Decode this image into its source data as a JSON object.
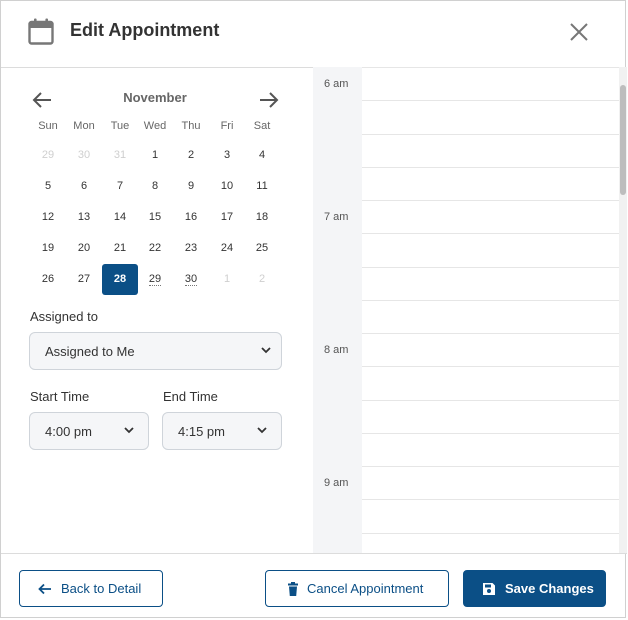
{
  "header": {
    "title": "Edit Appointment",
    "icon": "calendar-icon",
    "close_icon": "close-icon"
  },
  "calendar": {
    "month": "November",
    "weekdays": [
      "Sun",
      "Mon",
      "Tue",
      "Wed",
      "Thu",
      "Fri",
      "Sat"
    ],
    "weeks": [
      [
        {
          "d": "29",
          "m": true
        },
        {
          "d": "30",
          "m": true
        },
        {
          "d": "31",
          "m": true
        },
        {
          "d": "1"
        },
        {
          "d": "2"
        },
        {
          "d": "3"
        },
        {
          "d": "4"
        }
      ],
      [
        {
          "d": "5"
        },
        {
          "d": "6"
        },
        {
          "d": "7"
        },
        {
          "d": "8"
        },
        {
          "d": "9"
        },
        {
          "d": "10"
        },
        {
          "d": "11"
        }
      ],
      [
        {
          "d": "12"
        },
        {
          "d": "13"
        },
        {
          "d": "14"
        },
        {
          "d": "15"
        },
        {
          "d": "16"
        },
        {
          "d": "17"
        },
        {
          "d": "18"
        }
      ],
      [
        {
          "d": "19"
        },
        {
          "d": "20"
        },
        {
          "d": "21"
        },
        {
          "d": "22"
        },
        {
          "d": "23"
        },
        {
          "d": "24"
        },
        {
          "d": "25"
        }
      ],
      [
        {
          "d": "26"
        },
        {
          "d": "27"
        },
        {
          "d": "28",
          "s": true
        },
        {
          "d": "29",
          "u": true
        },
        {
          "d": "30",
          "u": true
        },
        {
          "d": "1",
          "m": true
        },
        {
          "d": "2",
          "m": true
        }
      ]
    ],
    "selected_day": "28"
  },
  "assigned": {
    "label": "Assigned to",
    "value": "Assigned to Me"
  },
  "start_time": {
    "label": "Start Time",
    "value": "4:00 pm"
  },
  "end_time": {
    "label": "End Time",
    "value": "4:15 pm"
  },
  "schedule": {
    "hours": [
      "6 am",
      "7 am",
      "8 am",
      "9 am"
    ]
  },
  "footer": {
    "back_label": "Back to Detail",
    "cancel_label": "Cancel Appointment",
    "save_label": "Save Changes"
  },
  "colors": {
    "primary": "#0b4f86",
    "border": "#d0d0d0",
    "gutter": "#f4f5f7"
  }
}
